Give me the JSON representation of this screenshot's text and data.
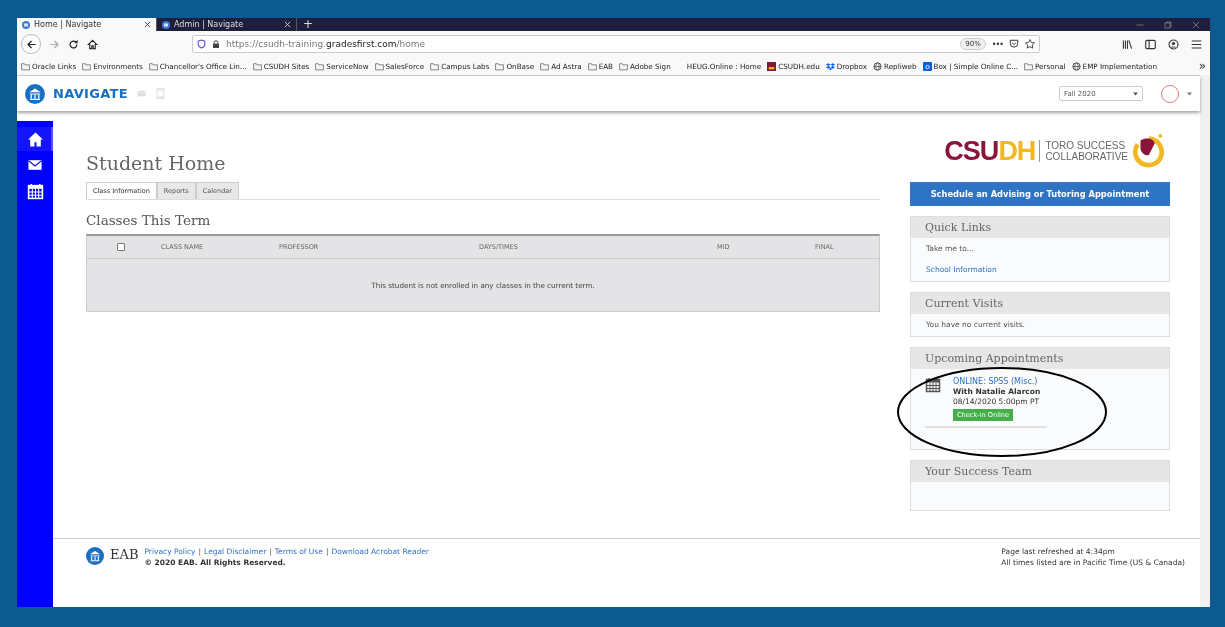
{
  "browser": {
    "tabs": [
      {
        "title": "Home | Navigate",
        "selected": true
      },
      {
        "title": "Admin | Navigate",
        "selected": false
      }
    ],
    "new_tab": "+",
    "url_prefix": "https://csudh-training.",
    "url_domain": "gradesfirst.com",
    "url_path": "/home",
    "zoom": "90%",
    "more": "•••",
    "bookmarks": [
      {
        "label": "Oracle Links",
        "kind": "folder"
      },
      {
        "label": "Environments",
        "kind": "folder"
      },
      {
        "label": "Chancellor's Office Lin...",
        "kind": "folder"
      },
      {
        "label": "CSUDH Sites",
        "kind": "folder"
      },
      {
        "label": "ServiceNow",
        "kind": "folder"
      },
      {
        "label": "SalesForce",
        "kind": "folder"
      },
      {
        "label": "Campus Labs",
        "kind": "folder"
      },
      {
        "label": "OnBase",
        "kind": "folder"
      },
      {
        "label": "Ad Astra",
        "kind": "folder"
      },
      {
        "label": "EAB",
        "kind": "folder"
      },
      {
        "label": "Adobe Sign",
        "kind": "folder"
      },
      {
        "label": "HEUG.Online : Home",
        "kind": "plain"
      },
      {
        "label": "CSUDH.edu",
        "kind": "seal"
      },
      {
        "label": "Dropbox",
        "kind": "dropbox"
      },
      {
        "label": "Repliweb",
        "kind": "globe"
      },
      {
        "label": "Box | Simple Online C...",
        "kind": "box"
      },
      {
        "label": "Personal",
        "kind": "folder"
      },
      {
        "label": "EMP Implementation",
        "kind": "globe"
      }
    ],
    "overflow": "»"
  },
  "app": {
    "brand": "NAVIGATE",
    "term": "Fall 2020",
    "sidebar": [
      {
        "kind": "home",
        "selected": true
      },
      {
        "kind": "mail",
        "selected": false
      },
      {
        "kind": "calendar",
        "selected": false
      }
    ]
  },
  "page": {
    "title": "Student Home",
    "tabs": [
      {
        "label": "Class Information",
        "selected": true
      },
      {
        "label": "Reports",
        "selected": false
      },
      {
        "label": "Calendar",
        "selected": false
      }
    ],
    "section": "Classes This Term",
    "table": {
      "select_all": {
        "checked": false
      },
      "columns": [
        "CLASS NAME",
        "PROFESSOR",
        "DAYS/TIMES",
        "MID",
        "FINAL"
      ],
      "empty_message": "This student is not enrolled in any classes in the current term."
    }
  },
  "sidebar": {
    "logo": {
      "wordmark": [
        "CSU",
        "DH"
      ],
      "line1": "TORO SUCCESS",
      "line2": "COLLABORATIVE"
    },
    "schedule_button": "Schedule an Advising or Tutoring Appointment",
    "quick_links": {
      "title": "Quick Links",
      "intro": "Take me to...",
      "links": [
        "School Information"
      ]
    },
    "current_visits": {
      "title": "Current Visits",
      "text": "You have no current visits."
    },
    "upcoming": {
      "title": "Upcoming Appointments",
      "appointments": [
        {
          "title": "ONLINE: SPSS (Misc.)",
          "with": "With Natalie Alarcon",
          "when": "08/14/2020 5:00pm PT",
          "action": "Check-in Online"
        }
      ]
    },
    "team": {
      "title": "Your Success Team"
    }
  },
  "footer": {
    "brand": "EAB",
    "links": [
      "Privacy Policy",
      "Legal Disclaimer",
      "Terms of Use",
      "Download Acrobat Reader"
    ],
    "separator": "|",
    "copyright": "© 2020 EAB. All Rights Reserved.",
    "refreshed": "Page last refreshed at 4:34pm",
    "timezone": "All times listed are in Pacific Time (US & Canada)"
  }
}
